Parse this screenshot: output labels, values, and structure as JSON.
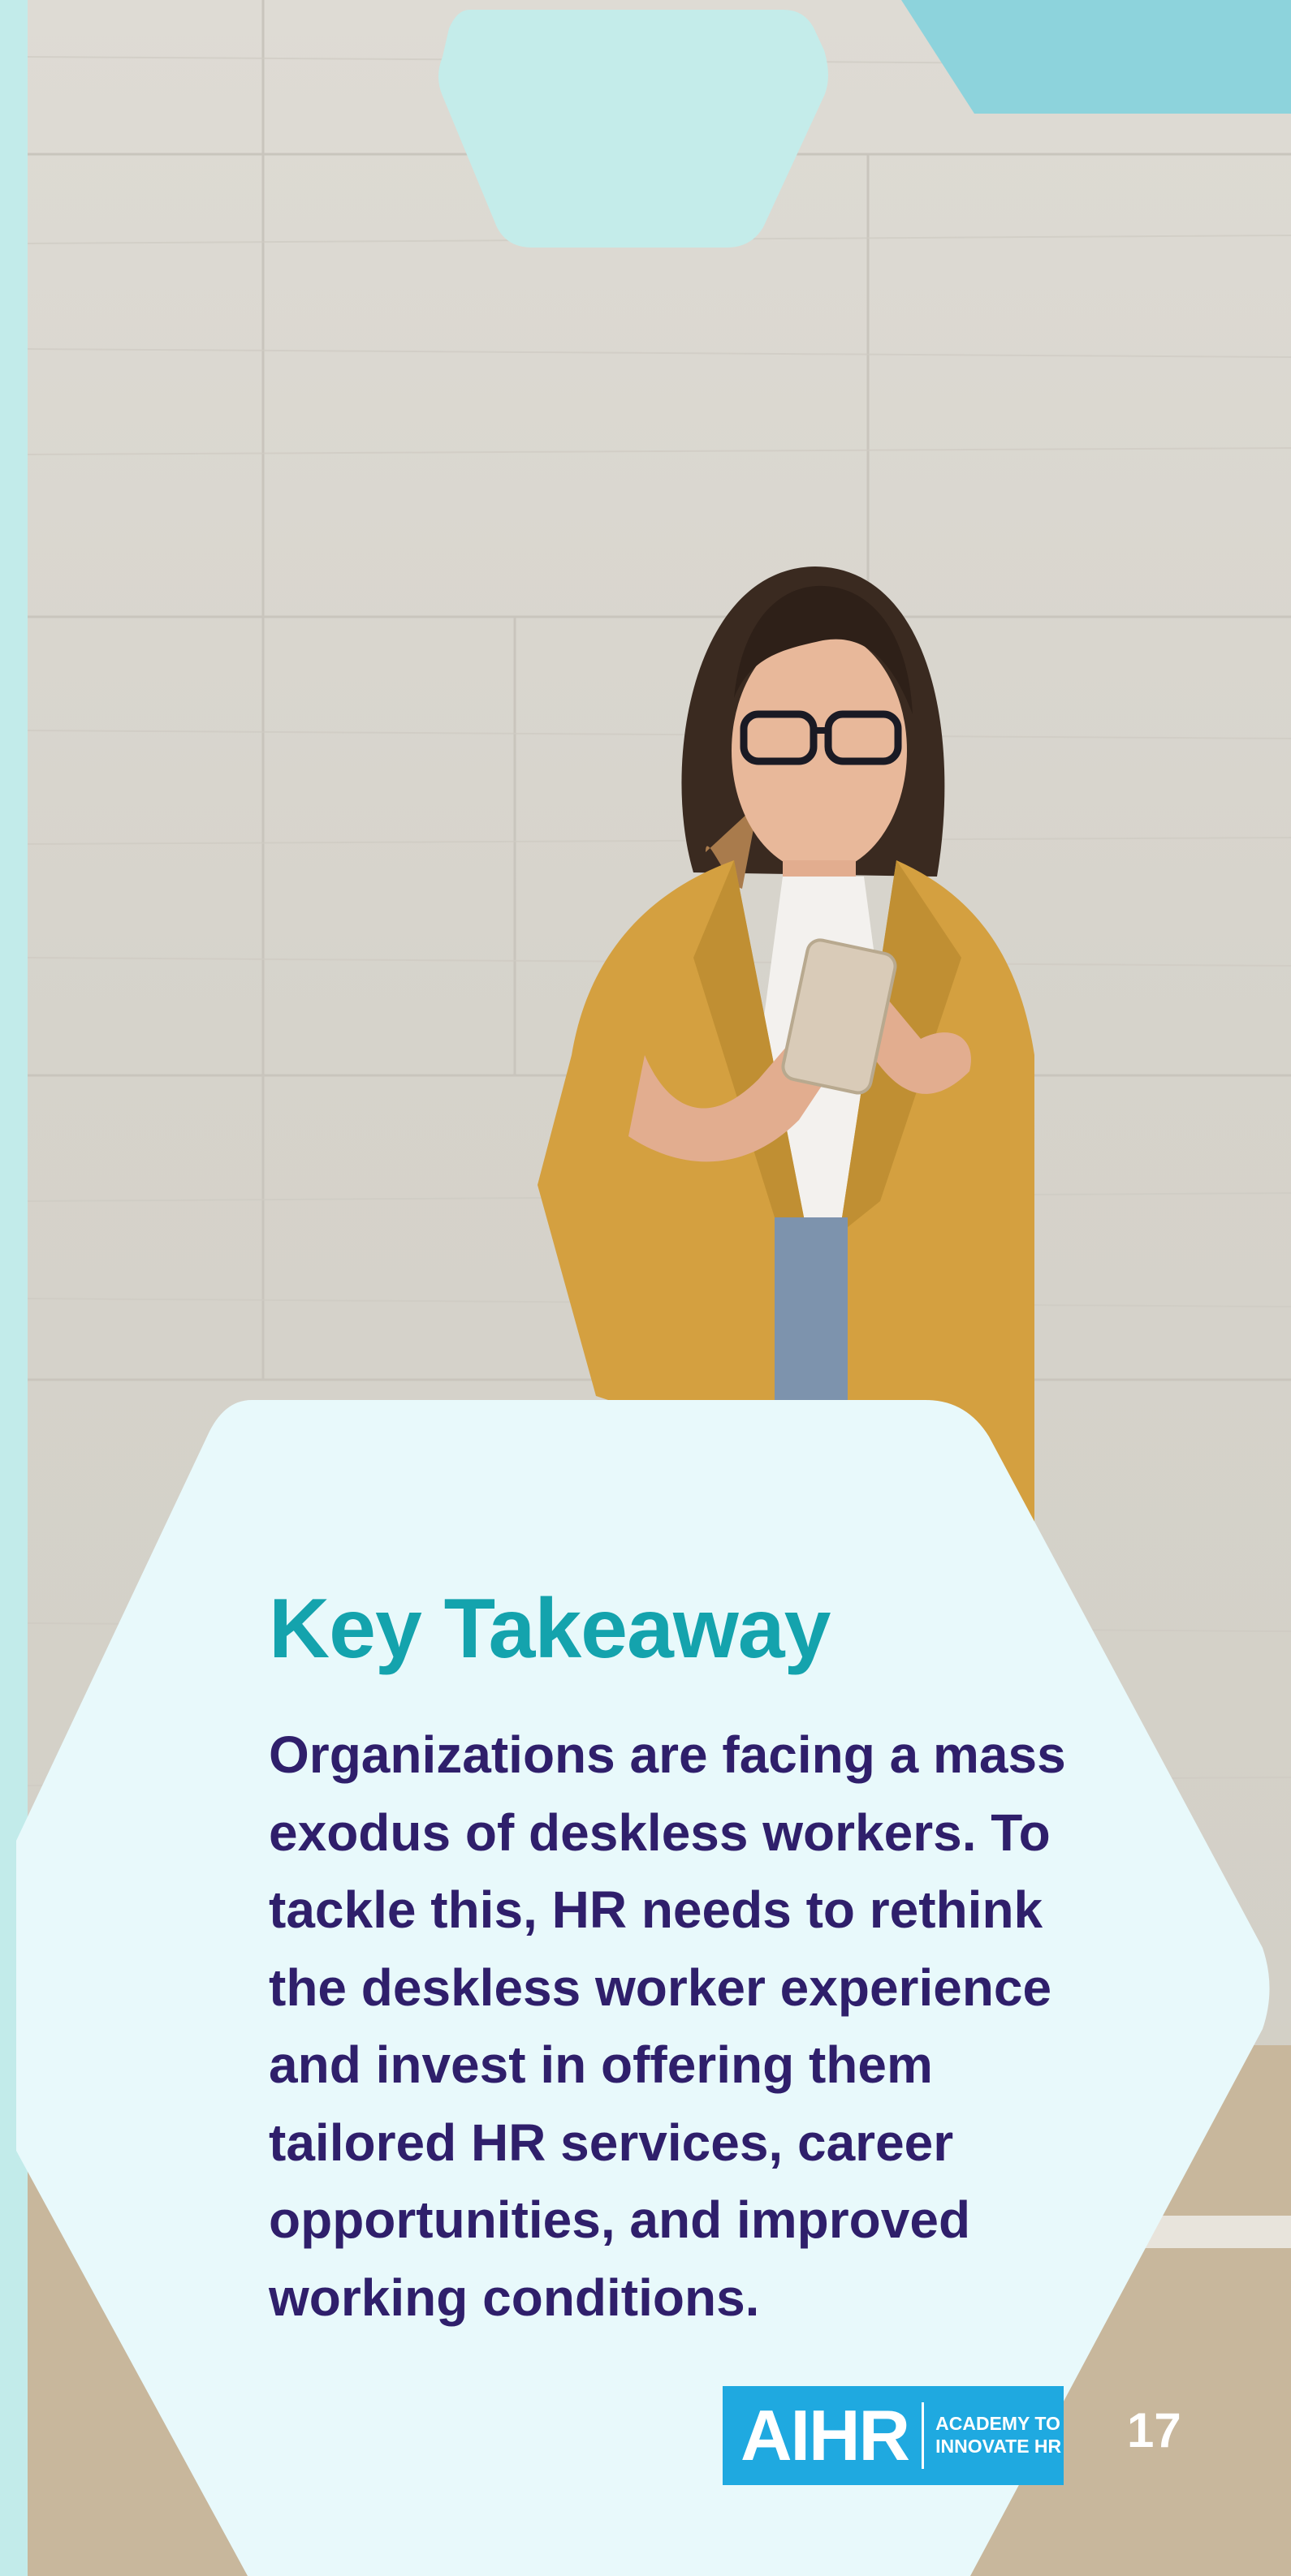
{
  "takeaway": {
    "heading": "Key Takeaway",
    "body": "Organizations are facing a mass exodus of deskless workers. To tackle this, HR needs to rethink the deskless worker experience and invest in offering them tailored HR services, career opportunities, and improved working conditions."
  },
  "logo": {
    "mark": "AIHR",
    "tagline_line1": "ACADEMY TO",
    "tagline_line2": "INNOVATE HR"
  },
  "page_number": "17",
  "colors": {
    "heading": "#14a3ad",
    "body_text": "#2f1f6b",
    "hexagon_fill": "#e8f9fb",
    "accent_light": "#c2ebea",
    "accent_mid": "#8dd3dc",
    "logo_blue": "#1fa9e0",
    "jacket": "#d4a040"
  }
}
